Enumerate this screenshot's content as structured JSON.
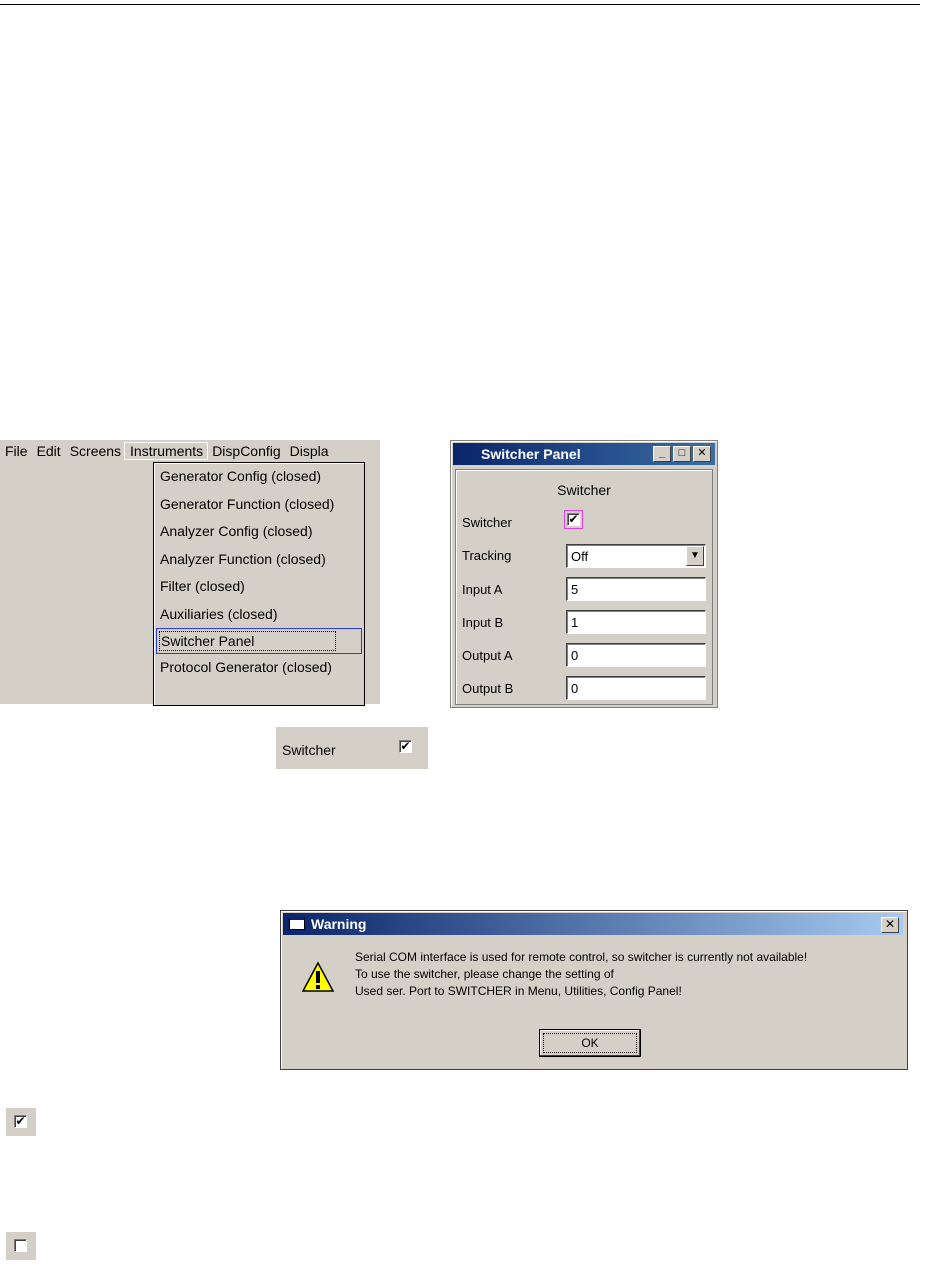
{
  "menubar": {
    "items": [
      "File",
      "Edit",
      "Screens",
      "Instruments",
      "DispConfig",
      "Displa"
    ]
  },
  "instruments_menu": {
    "items": [
      "Generator Config (closed)",
      "Generator Function (closed)",
      "Analyzer Config (closed)",
      "Analyzer Function (closed)",
      "Filter (closed)",
      "Auxiliaries (closed)",
      "Switcher Panel",
      "Protocol Generator (closed)"
    ]
  },
  "switcher_panel": {
    "title": "Switcher Panel",
    "section_title": "Switcher",
    "switcher_label": "Switcher",
    "switcher_checked": "✔",
    "tracking_label": "Tracking",
    "tracking_value": "Off",
    "input_a_label": "Input A",
    "input_a_value": "5",
    "input_b_label": "Input B",
    "input_b_value": "1",
    "output_a_label": "Output A",
    "output_a_value": "0",
    "output_b_label": "Output B",
    "output_b_value": "0"
  },
  "switcher_row": {
    "label": "Switcher",
    "check": "✔"
  },
  "warning_dialog": {
    "title": "Warning",
    "line1": "Serial COM interface is used for remote control, so switcher is currently not available!",
    "line2": "To use the switcher, please change the setting of",
    "line3": "Used ser. Port to SWITCHER in Menu, Utilities, Config Panel!",
    "ok_label": "OK"
  },
  "checkbox_icons": {
    "checked": "✔",
    "unchecked": ""
  }
}
